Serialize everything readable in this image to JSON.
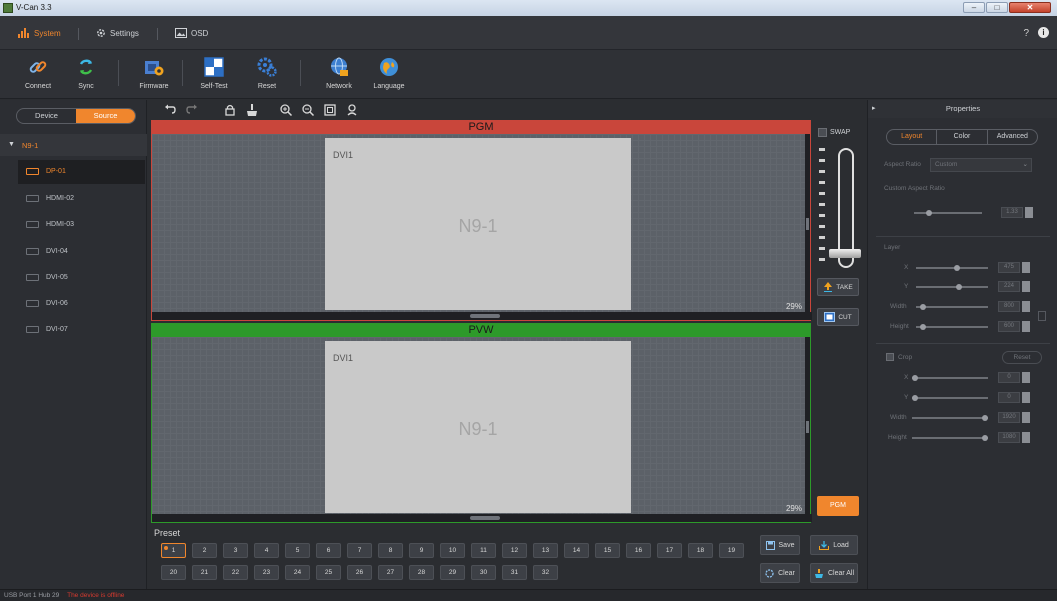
{
  "window": {
    "title": "V-Can 3.3",
    "minimize": "–",
    "maximize": "□",
    "close": "✕"
  },
  "menu": {
    "items": [
      {
        "label": "System",
        "icon": "system-icon"
      },
      {
        "label": "Settings",
        "icon": "gear-icon"
      },
      {
        "label": "OSD",
        "icon": "image-icon"
      }
    ],
    "help": "?",
    "info": "i"
  },
  "toolbar": {
    "connect": "Connect",
    "sync": "Sync",
    "firmware": "Firmware",
    "selftest": "Self-Test",
    "reset": "Reset",
    "network": "Network",
    "language": "Language"
  },
  "left": {
    "tabs": [
      "Device",
      "Source"
    ],
    "device": "N9-1",
    "sources": [
      "DP-01",
      "HDMI-02",
      "HDMI-03",
      "DVI-04",
      "DVI-05",
      "DVI-06",
      "DVI-07"
    ]
  },
  "pgm": {
    "label": "PGM",
    "layer_name": "DVI1",
    "layer_center": "N9-1",
    "zoom": "29%"
  },
  "pvw": {
    "label": "PVW",
    "layer_name": "DVI1",
    "layer_center": "N9-1",
    "zoom": "29%"
  },
  "take": {
    "swap": "SWAP",
    "take": "TAKE",
    "cut": "CUT",
    "pgm": "PGM"
  },
  "properties": {
    "title": "Properties",
    "tabs": [
      "Layout",
      "Color",
      "Advanced"
    ],
    "aspect_ratio_label": "Aspect Ratio",
    "aspect_ratio_value": "Custom",
    "custom_aspect_label": "Custom Aspect Ratio",
    "custom_aspect_value": "1.33",
    "layer_label": "Layer",
    "layer_fields": [
      {
        "label": "X",
        "value": "475"
      },
      {
        "label": "Y",
        "value": "224"
      },
      {
        "label": "Width",
        "value": "800"
      },
      {
        "label": "Height",
        "value": "600"
      }
    ],
    "crop_label": "Crop",
    "reset_label": "Reset",
    "crop_fields": [
      {
        "label": "X",
        "value": "0"
      },
      {
        "label": "Y",
        "value": "0"
      },
      {
        "label": "Width",
        "value": "1920"
      },
      {
        "label": "Height",
        "value": "1080"
      }
    ]
  },
  "preset": {
    "title": "Preset",
    "row1": [
      "1",
      "2",
      "3",
      "4",
      "5",
      "6",
      "7",
      "8",
      "9",
      "10",
      "11",
      "12",
      "13",
      "14",
      "15",
      "16",
      "17",
      "18",
      "19"
    ],
    "row2": [
      "20",
      "21",
      "22",
      "23",
      "24",
      "25",
      "26",
      "27",
      "28",
      "29",
      "30",
      "31",
      "32"
    ],
    "save": "Save",
    "load": "Load",
    "clear": "Clear",
    "clear_all": "Clear All"
  },
  "status": {
    "port": "USB Port 1 Hub 29",
    "warning": "The device is offline"
  },
  "colors": {
    "accent": "#f0862d",
    "pgm": "#c9463b",
    "pvw": "#2d9a2a",
    "background": "#2b2d31"
  }
}
